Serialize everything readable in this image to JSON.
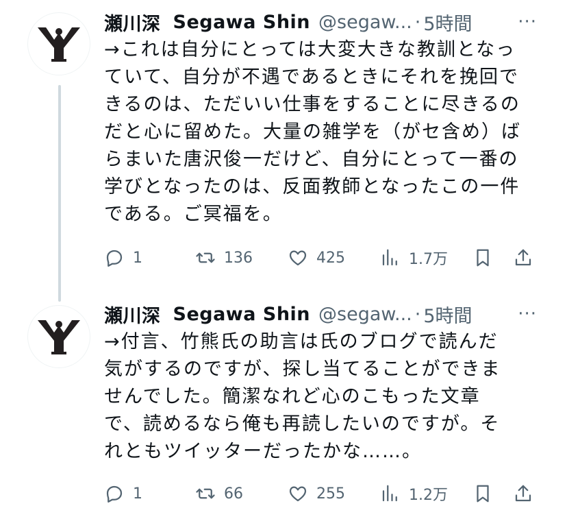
{
  "tweets": [
    {
      "author_name": "瀬川深",
      "author_name_en": "Segawa Shin",
      "handle": "@segaw...",
      "dot": "·",
      "time": "5時間",
      "more": "···",
      "lines": [
        "→これは自分にとっては大変大きな教訓となっ",
        "ていて、自分が不遇であるときにそれを挽回で",
        "きるのは、ただいい仕事をすることに尽きるの",
        "だと心に留めた。大量の雑学を（がセ含め）ば",
        "らまいた唐沢俊一だけど、自分にとって一番の",
        "学びとなったのは、反面教師となったこの一件",
        "である。ご冥福を。"
      ],
      "replies": "1",
      "retweets": "136",
      "likes": "425",
      "views": "1.7万"
    },
    {
      "author_name": "瀬川深",
      "author_name_en": "Segawa Shin",
      "handle": "@segaw...",
      "dot": "·",
      "time": "5時間",
      "more": "···",
      "lines": [
        "→付言、竹熊氏の助言は氏のブログで読んだ",
        "気がするのですが、探し当てることができま",
        "せんでした。簡潔なれど心のこもった文章",
        "で、読めるなら俺も再読したいのですが。そ",
        "れともツイッターだったかな……。"
      ],
      "replies": "1",
      "retweets": "66",
      "likes": "255",
      "views": "1.2万"
    }
  ],
  "icons": {
    "avatar": "yy-logo-icon",
    "reply": "reply-icon",
    "retweet": "retweet-icon",
    "like": "heart-icon",
    "views": "views-icon",
    "bookmark": "bookmark-icon",
    "share": "share-icon"
  },
  "colors": {
    "text": "#0f1419",
    "secondary": "#536471",
    "thread_line": "#cfd9de"
  }
}
